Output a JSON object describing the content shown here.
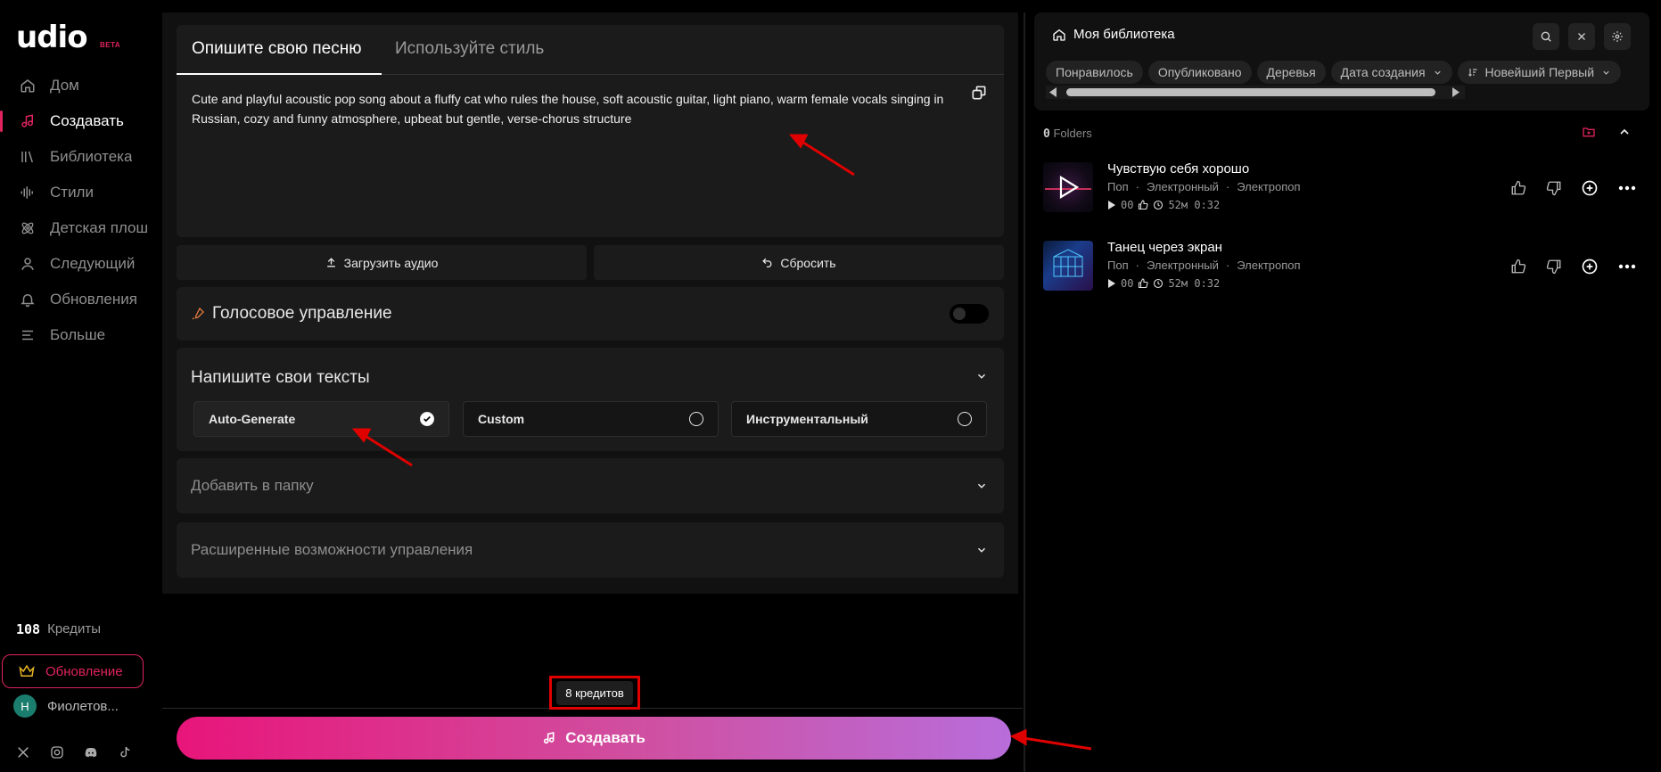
{
  "sidebar": {
    "logo": "udio",
    "logo_badge": "BETA",
    "items": [
      {
        "label": "Дом",
        "icon": "home-icon"
      },
      {
        "label": "Создавать",
        "icon": "music-note-icon",
        "active": true
      },
      {
        "label": "Библиотека",
        "icon": "library-icon"
      },
      {
        "label": "Стили",
        "icon": "waveform-icon"
      },
      {
        "label": "Детская плош",
        "icon": "atom-icon"
      },
      {
        "label": "Следующий",
        "icon": "user-icon"
      },
      {
        "label": "Обновления",
        "icon": "bell-icon"
      },
      {
        "label": "Больше",
        "icon": "menu-icon"
      }
    ],
    "credits_value": "108",
    "credits_label": "Кредиты",
    "upgrade_label": "Обновление",
    "user_initial": "Н",
    "user_name": "Фиолетов..."
  },
  "main": {
    "tabs": [
      {
        "label": "Опишите свою песню",
        "active": true
      },
      {
        "label": "Используйте стиль",
        "active": false
      }
    ],
    "prompt_text": "Cute and playful acoustic pop song about a fluffy cat who rules the house, soft acoustic guitar, light piano, warm female vocals singing in Russian, cozy and funny atmosphere, upbeat but gentle, verse-chorus structure",
    "upload_label": "Загрузить аудио",
    "reset_label": "Сбросить",
    "voice_control_label": "Голосовое управление",
    "voice_control_enabled": false,
    "lyrics_title": "Напишите свои тексты",
    "lyrics_options": [
      {
        "label": "Auto-Generate",
        "selected": true
      },
      {
        "label": "Custom",
        "selected": false
      },
      {
        "label": "Инструментальный",
        "selected": false
      }
    ],
    "add_to_folder_label": "Добавить в папку",
    "advanced_label": "Расширенные возможности управления",
    "cost_label": "8 кредитов",
    "create_label": "Создавать"
  },
  "library": {
    "title": "Моя библиотека",
    "chips": [
      "Понравилось",
      "Опубликовано",
      "Деревья",
      "Дата создания",
      "Новейший Первый"
    ],
    "folders_count": "0",
    "folders_label": "Folders",
    "tracks": [
      {
        "title": "Чувствую себя хорошо",
        "tags": [
          "Поп",
          "·",
          "Электронный",
          "·",
          "Электропоп"
        ],
        "plays": "00",
        "duration": "52м 0:32"
      },
      {
        "title": "Танец через экран",
        "tags": [
          "Поп",
          "·",
          "Электронный",
          "·",
          "Электропоп"
        ],
        "plays": "00",
        "duration": "52м 0:32"
      }
    ]
  },
  "colors": {
    "accent": "#e0245e",
    "annotation_red": "#e00000"
  }
}
